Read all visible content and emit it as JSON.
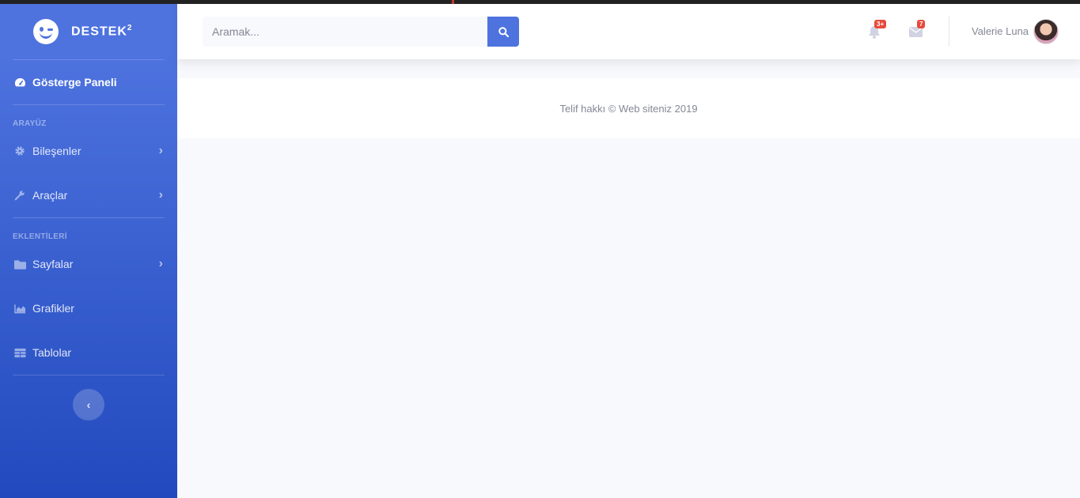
{
  "brand": {
    "name": "DESTEK",
    "sup": "2"
  },
  "sidebar": {
    "dashboard": "Gösterge Paneli",
    "heading_interface": "ARAYÜZ",
    "components": "Bileşenler",
    "utilities": "Araçlar",
    "heading_addons": "EKLENTİLERİ",
    "pages": "Sayfalar",
    "charts": "Grafikler",
    "tables": "Tablolar"
  },
  "topbar": {
    "search_placeholder": "Aramak...",
    "alerts_count": "3+",
    "messages_count": "7",
    "user_name": "Valerie Luna"
  },
  "footer": {
    "copyright": "Telif hakkı © Web siteniz 2019"
  },
  "colors": {
    "primary": "#4e73df",
    "primary_dark": "#224abe",
    "danger": "#e74a3b",
    "text_muted": "#858796"
  }
}
